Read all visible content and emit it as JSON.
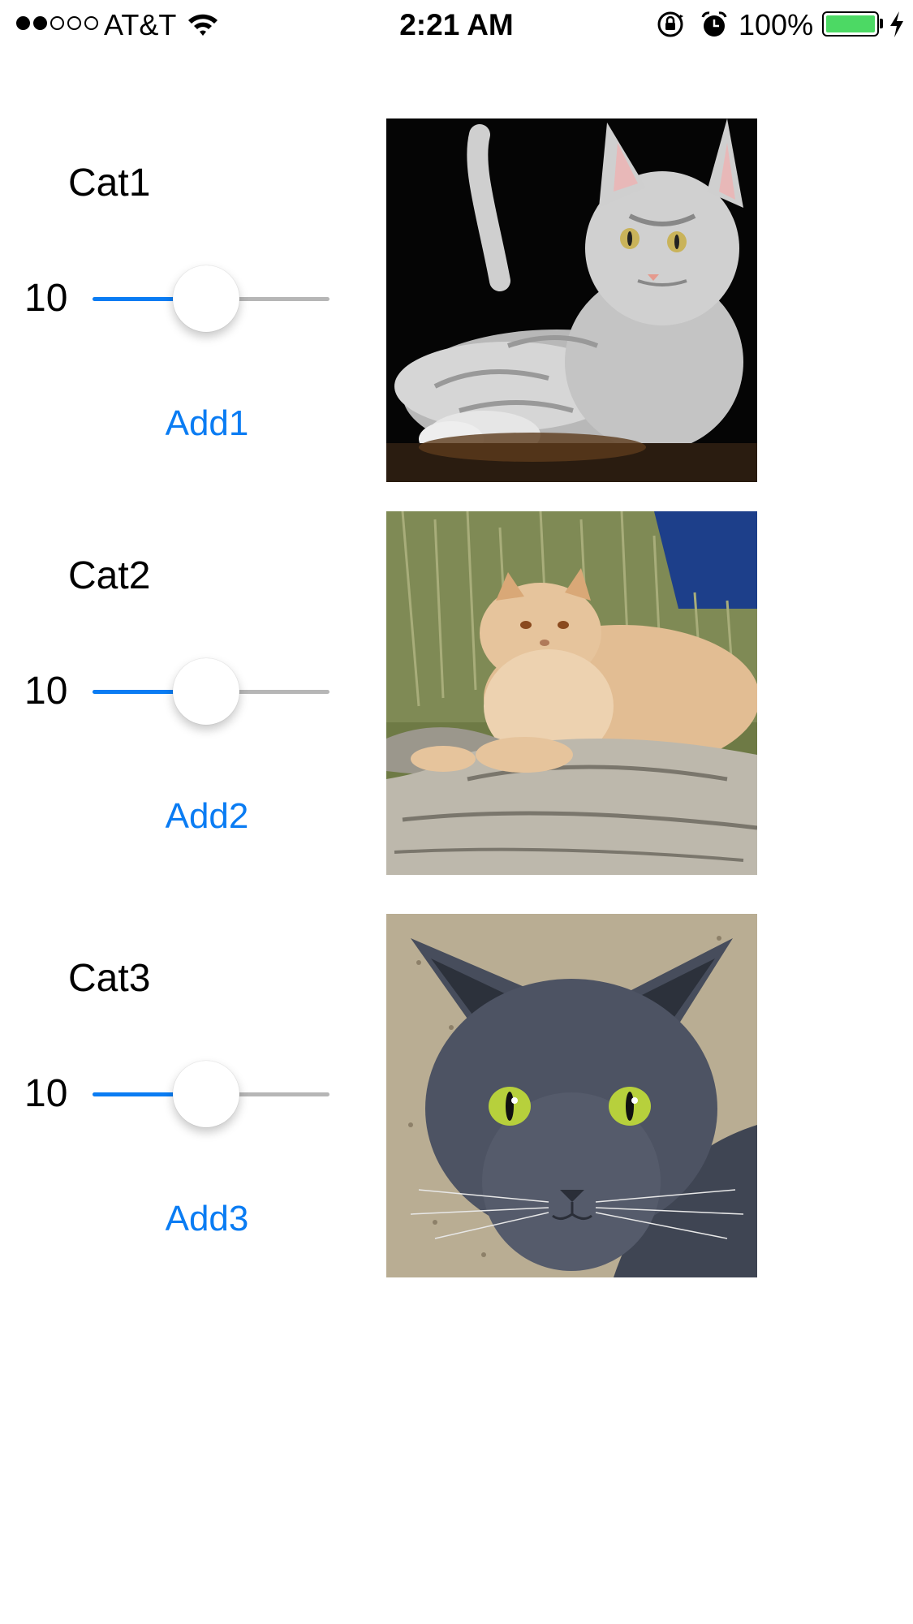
{
  "status_bar": {
    "signal_dots_filled": 2,
    "signal_dots_total": 5,
    "carrier": "AT&T",
    "time": "2:21 AM",
    "battery_percent": "100%",
    "battery_level": 1.0,
    "battery_color": "#4cd964",
    "icons": [
      "wifi-icon",
      "rotation-lock-icon",
      "alarm-icon",
      "battery-icon",
      "charging-icon"
    ]
  },
  "accent_color": "#0a7cf3",
  "cats": [
    {
      "title": "Cat1",
      "slider_value": "10",
      "slider_level": 0.48,
      "add_label": "Add1",
      "photo": "grey tabby kitten on black background"
    },
    {
      "title": "Cat2",
      "slider_value": "10",
      "slider_level": 0.48,
      "add_label": "Add2",
      "photo": "cream persian cat on rocks"
    },
    {
      "title": "Cat3",
      "slider_value": "10",
      "slider_level": 0.48,
      "add_label": "Add3",
      "photo": "grey cat with green eyes"
    }
  ]
}
